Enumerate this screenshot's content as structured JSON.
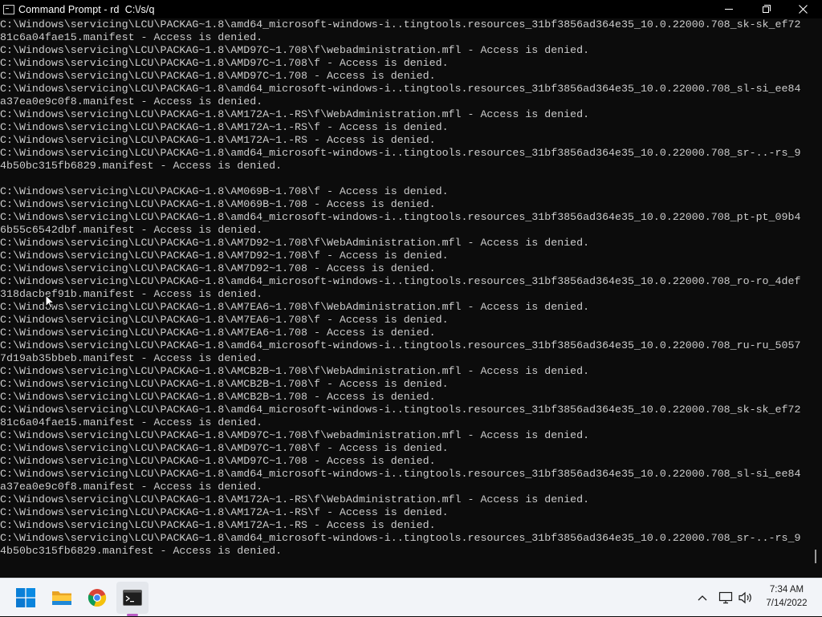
{
  "window": {
    "title": "Command Prompt - rd  C:\\/s/q",
    "icon": "cmd-icon",
    "controls": [
      "minimize-icon",
      "maximize-icon",
      "close-icon"
    ]
  },
  "console": {
    "background": "#0c0c0c",
    "foreground": "#cccccc",
    "lines": [
      "C:\\Windows\\servicing\\LCU\\PACKAG~1.8\\amd64_microsoft-windows-i..tingtools.resources_31bf3856ad364e35_10.0.22000.708_sk-sk_ef72",
      "81c6a04fae15.manifest - Access is denied.",
      "C:\\Windows\\servicing\\LCU\\PACKAG~1.8\\AMD97C~1.708\\f\\webadministration.mfl - Access is denied.",
      "C:\\Windows\\servicing\\LCU\\PACKAG~1.8\\AMD97C~1.708\\f - Access is denied.",
      "C:\\Windows\\servicing\\LCU\\PACKAG~1.8\\AMD97C~1.708 - Access is denied.",
      "C:\\Windows\\servicing\\LCU\\PACKAG~1.8\\amd64_microsoft-windows-i..tingtools.resources_31bf3856ad364e35_10.0.22000.708_sl-si_ee84",
      "a37ea0e9c0f8.manifest - Access is denied.",
      "C:\\Windows\\servicing\\LCU\\PACKAG~1.8\\AM172A~1.-RS\\f\\WebAdministration.mfl - Access is denied.",
      "C:\\Windows\\servicing\\LCU\\PACKAG~1.8\\AM172A~1.-RS\\f - Access is denied.",
      "C:\\Windows\\servicing\\LCU\\PACKAG~1.8\\AM172A~1.-RS - Access is denied.",
      "C:\\Windows\\servicing\\LCU\\PACKAG~1.8\\amd64_microsoft-windows-i..tingtools.resources_31bf3856ad364e35_10.0.22000.708_sr-..-rs_9",
      "4b50bc315fb6829.manifest - Access is denied.",
      "",
      "C:\\Windows\\servicing\\LCU\\PACKAG~1.8\\AM069B~1.708\\f - Access is denied.",
      "C:\\Windows\\servicing\\LCU\\PACKAG~1.8\\AM069B~1.708 - Access is denied.",
      "C:\\Windows\\servicing\\LCU\\PACKAG~1.8\\amd64_microsoft-windows-i..tingtools.resources_31bf3856ad364e35_10.0.22000.708_pt-pt_09b4",
      "6b55c6542dbf.manifest - Access is denied.",
      "C:\\Windows\\servicing\\LCU\\PACKAG~1.8\\AM7D92~1.708\\f\\WebAdministration.mfl - Access is denied.",
      "C:\\Windows\\servicing\\LCU\\PACKAG~1.8\\AM7D92~1.708\\f - Access is denied.",
      "C:\\Windows\\servicing\\LCU\\PACKAG~1.8\\AM7D92~1.708 - Access is denied.",
      "C:\\Windows\\servicing\\LCU\\PACKAG~1.8\\amd64_microsoft-windows-i..tingtools.resources_31bf3856ad364e35_10.0.22000.708_ro-ro_4def",
      "318dacbef91b.manifest - Access is denied.",
      "C:\\Windows\\servicing\\LCU\\PACKAG~1.8\\AM7EA6~1.708\\f\\WebAdministration.mfl - Access is denied.",
      "C:\\Windows\\servicing\\LCU\\PACKAG~1.8\\AM7EA6~1.708\\f - Access is denied.",
      "C:\\Windows\\servicing\\LCU\\PACKAG~1.8\\AM7EA6~1.708 - Access is denied.",
      "C:\\Windows\\servicing\\LCU\\PACKAG~1.8\\amd64_microsoft-windows-i..tingtools.resources_31bf3856ad364e35_10.0.22000.708_ru-ru_5057",
      "7d19ab35bbeb.manifest - Access is denied.",
      "C:\\Windows\\servicing\\LCU\\PACKAG~1.8\\AMCB2B~1.708\\f\\WebAdministration.mfl - Access is denied.",
      "C:\\Windows\\servicing\\LCU\\PACKAG~1.8\\AMCB2B~1.708\\f - Access is denied.",
      "C:\\Windows\\servicing\\LCU\\PACKAG~1.8\\AMCB2B~1.708 - Access is denied.",
      "C:\\Windows\\servicing\\LCU\\PACKAG~1.8\\amd64_microsoft-windows-i..tingtools.resources_31bf3856ad364e35_10.0.22000.708_sk-sk_ef72",
      "81c6a04fae15.manifest - Access is denied.",
      "C:\\Windows\\servicing\\LCU\\PACKAG~1.8\\AMD97C~1.708\\f\\webadministration.mfl - Access is denied.",
      "C:\\Windows\\servicing\\LCU\\PACKAG~1.8\\AMD97C~1.708\\f - Access is denied.",
      "C:\\Windows\\servicing\\LCU\\PACKAG~1.8\\AMD97C~1.708 - Access is denied.",
      "C:\\Windows\\servicing\\LCU\\PACKAG~1.8\\amd64_microsoft-windows-i..tingtools.resources_31bf3856ad364e35_10.0.22000.708_sl-si_ee84",
      "a37ea0e9c0f8.manifest - Access is denied.",
      "C:\\Windows\\servicing\\LCU\\PACKAG~1.8\\AM172A~1.-RS\\f\\WebAdministration.mfl - Access is denied.",
      "C:\\Windows\\servicing\\LCU\\PACKAG~1.8\\AM172A~1.-RS\\f - Access is denied.",
      "C:\\Windows\\servicing\\LCU\\PACKAG~1.8\\AM172A~1.-RS - Access is denied.",
      "C:\\Windows\\servicing\\LCU\\PACKAG~1.8\\amd64_microsoft-windows-i..tingtools.resources_31bf3856ad364e35_10.0.22000.708_sr-..-rs_9",
      "4b50bc315fb6829.manifest - Access is denied."
    ]
  },
  "taskbar": {
    "apps": [
      {
        "name": "start-icon",
        "active": false
      },
      {
        "name": "file-explorer-icon",
        "active": false
      },
      {
        "name": "chrome-icon",
        "active": false
      },
      {
        "name": "command-prompt-icon",
        "active": true
      }
    ],
    "tray_icons": [
      "chevron-up-icon",
      "network-icon",
      "volume-icon"
    ],
    "clock": {
      "time": "7:34 AM",
      "date": "7/14/2022"
    },
    "accent": "#0078d4",
    "active_indicator": "#bb5cc4"
  }
}
